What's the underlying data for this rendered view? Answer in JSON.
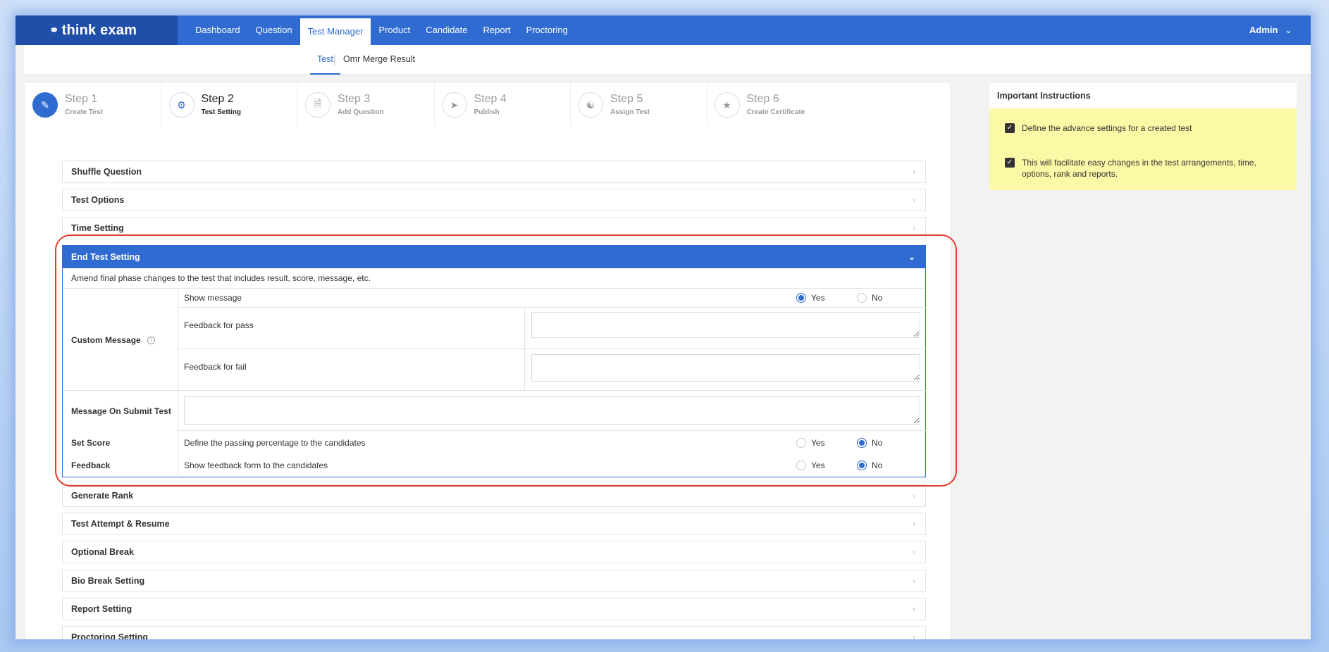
{
  "nav": {
    "logo": "think exam",
    "items": [
      "Dashboard",
      "Question",
      "Test Manager",
      "Product",
      "Candidate",
      "Report",
      "Proctoring"
    ],
    "user": "Admin"
  },
  "subnav": {
    "tabs": [
      "Test",
      "Omr Merge Result"
    ]
  },
  "steps": [
    {
      "number": "Step 1",
      "label": "Create Test"
    },
    {
      "number": "Step 2",
      "label": "Test Setting"
    },
    {
      "number": "Step 3",
      "label": "Add Question"
    },
    {
      "number": "Step 4",
      "label": "Publish"
    },
    {
      "number": "Step 5",
      "label": "Assign Test"
    },
    {
      "number": "Step 6",
      "label": "Create Certificate"
    }
  ],
  "accordion": {
    "shuffle": "Shuffle Question",
    "test_options": "Test Options",
    "time_setting": "Time Setting",
    "end_test": "End Test Setting",
    "generate_rank": "Generate Rank",
    "attempt_resume": "Test Attempt & Resume",
    "optional_break": "Optional Break",
    "bio_break": "Bio Break Setting",
    "report_setting": "Report Setting",
    "proctoring_setting": "Proctoring Setting"
  },
  "end_test": {
    "description": "Amend final phase changes to the test that includes result, score, message, etc.",
    "custom_message_label": "Custom Message",
    "show_message": "Show message",
    "show_message_value": "Yes",
    "feedback_pass": "Feedback for pass",
    "feedback_fail": "Feedback for fail",
    "message_on_submit": "Message On Submit Test",
    "set_score_label": "Set Score",
    "set_score_desc": "Define the passing percentage to the candidates",
    "set_score_value": "No",
    "feedback_label": "Feedback",
    "feedback_desc": "Show feedback form to the candidates",
    "feedback_value": "No",
    "yes": "Yes",
    "no": "No"
  },
  "instructions": {
    "title": "Important Instructions",
    "items": [
      "Define the advance settings for a created test",
      "This will facilitate easy changes in the test arrangements, time, options, rank and reports."
    ]
  },
  "colors": {
    "primary": "#2f6bd0",
    "highlight": "#e03b2e",
    "note_bg": "#fbf8a6"
  }
}
